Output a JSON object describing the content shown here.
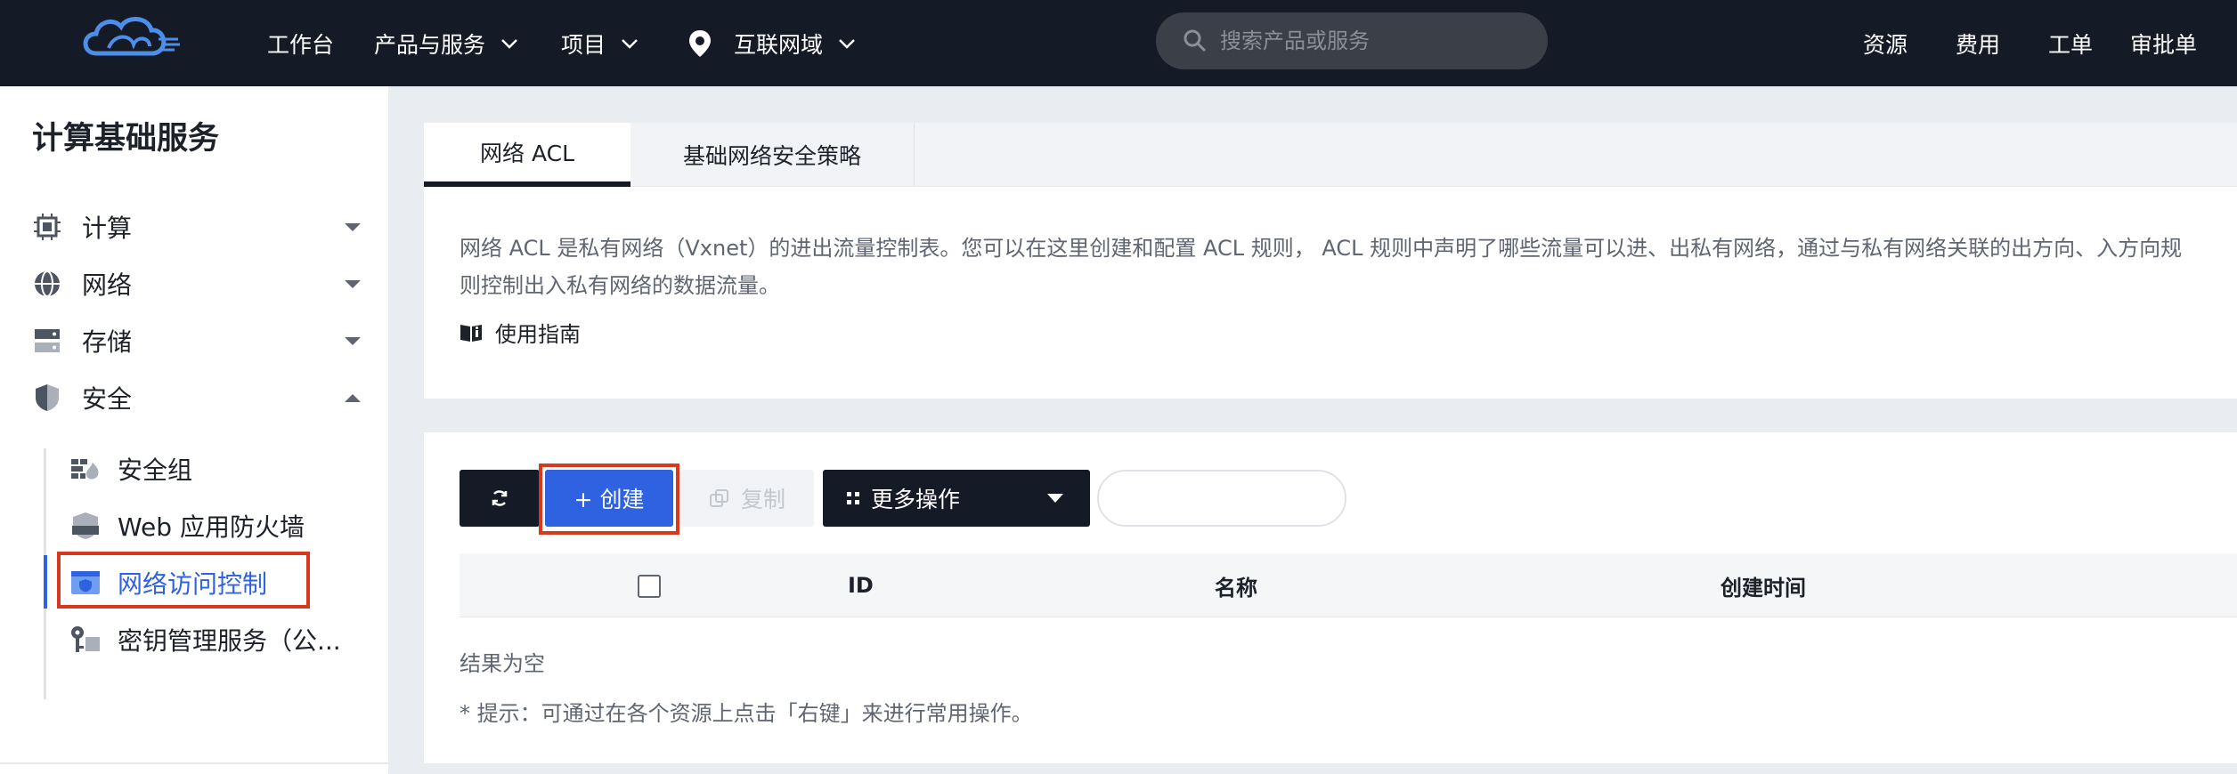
{
  "topbar": {
    "logo_icon": "cloud-logo-icon",
    "nav": {
      "workbench": "工作台",
      "products": "产品与服务",
      "projects": "项目",
      "region": "互联网域"
    },
    "search_placeholder": "搜索产品或服务",
    "right": {
      "resources": "资源",
      "billing": "费用",
      "tickets": "工单",
      "approvals": "审批单"
    }
  },
  "sidebar": {
    "title": "计算基础服务",
    "groups": [
      {
        "label": "计算",
        "icon": "cpu-icon",
        "expanded": false
      },
      {
        "label": "网络",
        "icon": "globe-icon",
        "expanded": false
      },
      {
        "label": "存储",
        "icon": "storage-icon",
        "expanded": false
      },
      {
        "label": "安全",
        "icon": "shield-icon",
        "expanded": true
      }
    ],
    "security_items": [
      {
        "label": "安全组",
        "icon": "firewall-icon"
      },
      {
        "label": "Web 应用防火墙",
        "icon": "waf-icon"
      },
      {
        "label": "网络访问控制",
        "icon": "acl-icon",
        "active": true
      },
      {
        "label": "密钥管理服务（公...",
        "icon": "key-icon"
      }
    ]
  },
  "main": {
    "tabs": [
      {
        "label": "网络 ACL",
        "active": true
      },
      {
        "label": "基础网络安全策略",
        "active": false
      }
    ],
    "description": "网络 ACL 是私有网络（Vxnet）的进出流量控制表。您可以在这里创建和配置 ACL 规则， ACL 规则中声明了哪些流量可以进、出私有网络，通过与私有网络关联的出方向、入方向规则控制出入私有网络的数据流量。",
    "guide_label": "使用指南",
    "toolbar": {
      "create_label": "+ 创建",
      "copy_label": "复制",
      "more_label": "更多操作",
      "filter_value": ""
    },
    "table": {
      "columns": [
        "ID",
        "名称",
        "创建时间"
      ],
      "empty_text": "结果为空",
      "tip": "* 提示：可通过在各个资源上点击「右键」来进行常用操作。"
    }
  },
  "colors": {
    "topbar_bg": "#151b26",
    "accent": "#2f62e0",
    "highlight": "#d8381d"
  }
}
